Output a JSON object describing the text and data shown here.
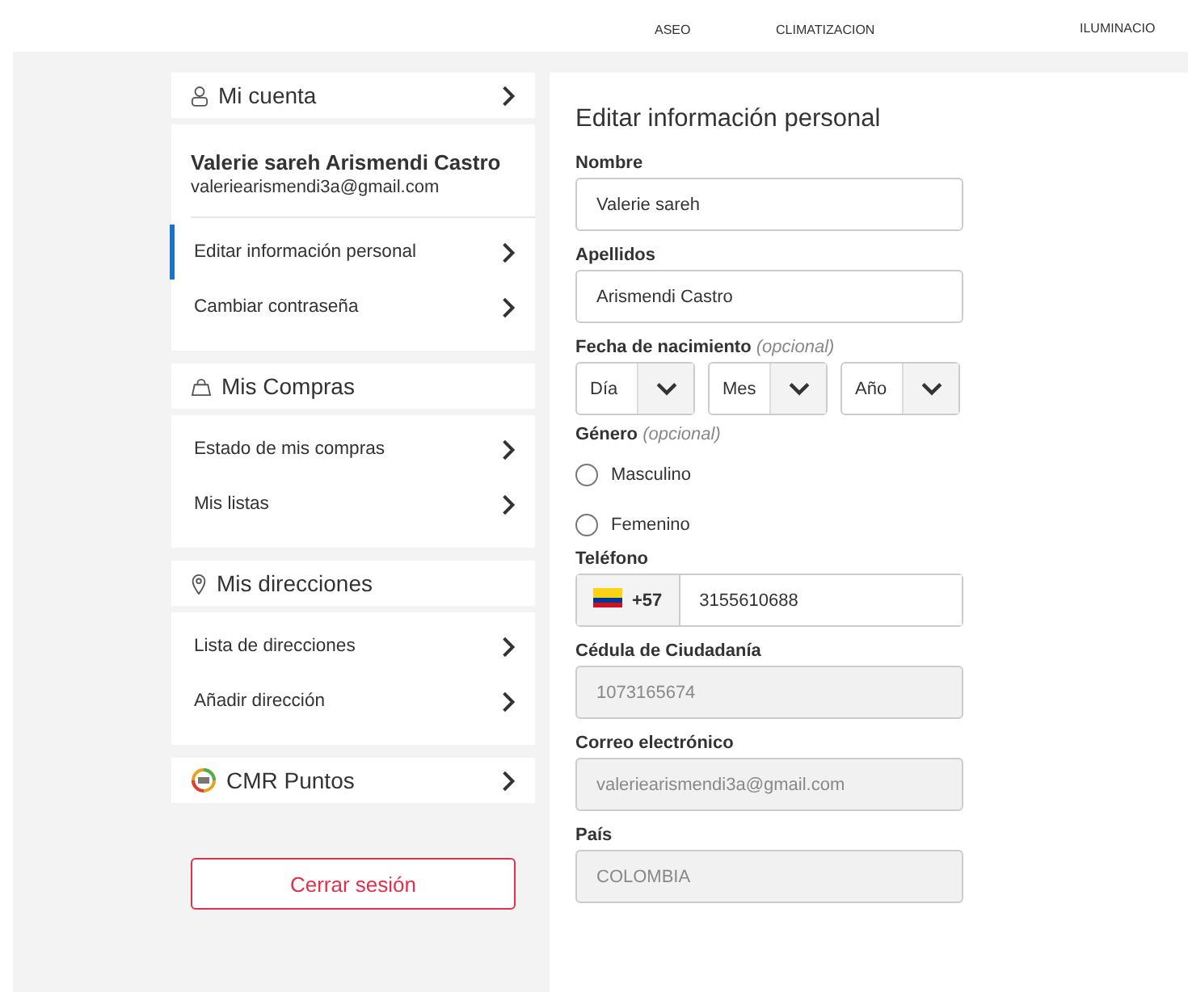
{
  "nav": [
    "ASEO",
    "CLIMATIZACION",
    "ILUMINACIO"
  ],
  "sidebar": [
    {
      "title": "Mi cuenta",
      "chevron": true,
      "user": {
        "name": "Valerie sareh Arismendi Castro",
        "email": "valeriearismendi3a@gmail.com"
      },
      "items": [
        {
          "label": "Editar información personal",
          "selected": true
        },
        {
          "label": "Cambiar contraseña",
          "selected": false
        }
      ]
    },
    {
      "title": "Mis Compras",
      "chevron": false,
      "items": [
        {
          "label": "Estado de mis compras",
          "selected": false
        },
        {
          "label": "Mis listas",
          "selected": false
        }
      ]
    },
    {
      "title": "Mis direcciones",
      "chevron": false,
      "items": [
        {
          "label": "Lista de direcciones",
          "selected": false
        },
        {
          "label": "Añadir dirección",
          "selected": false
        }
      ]
    },
    {
      "title": "CMR Puntos",
      "chevron": true
    }
  ],
  "logout": "Cerrar sesión",
  "form": {
    "title": "Editar información personal",
    "fields": [
      {
        "kind": "text",
        "label": "Nombre",
        "value": "Valerie sareh"
      },
      {
        "kind": "text",
        "label": "Apellidos",
        "value": "Arismendi Castro"
      },
      {
        "kind": "date",
        "label": "Fecha de nacimiento",
        "hint": "(opcional)",
        "selects": [
          "Día",
          "Mes",
          "Año"
        ]
      },
      {
        "kind": "radio",
        "label": "Género",
        "hint": "(opcional)",
        "options": [
          {
            "label": "Masculino",
            "selected": false
          },
          {
            "label": "Femenino",
            "selected": false
          }
        ]
      },
      {
        "kind": "phone",
        "label": "Teléfono",
        "prefix": "+57",
        "value": "3155610688"
      },
      {
        "kind": "disabled",
        "label": "Cédula de Ciudadanía",
        "value": "1073165674"
      },
      {
        "kind": "disabled",
        "label": "Correo electrónico",
        "value": "valeriearismendi3a@gmail.com"
      },
      {
        "kind": "disabled",
        "label": "País",
        "value": "COLOMBIA"
      }
    ]
  }
}
